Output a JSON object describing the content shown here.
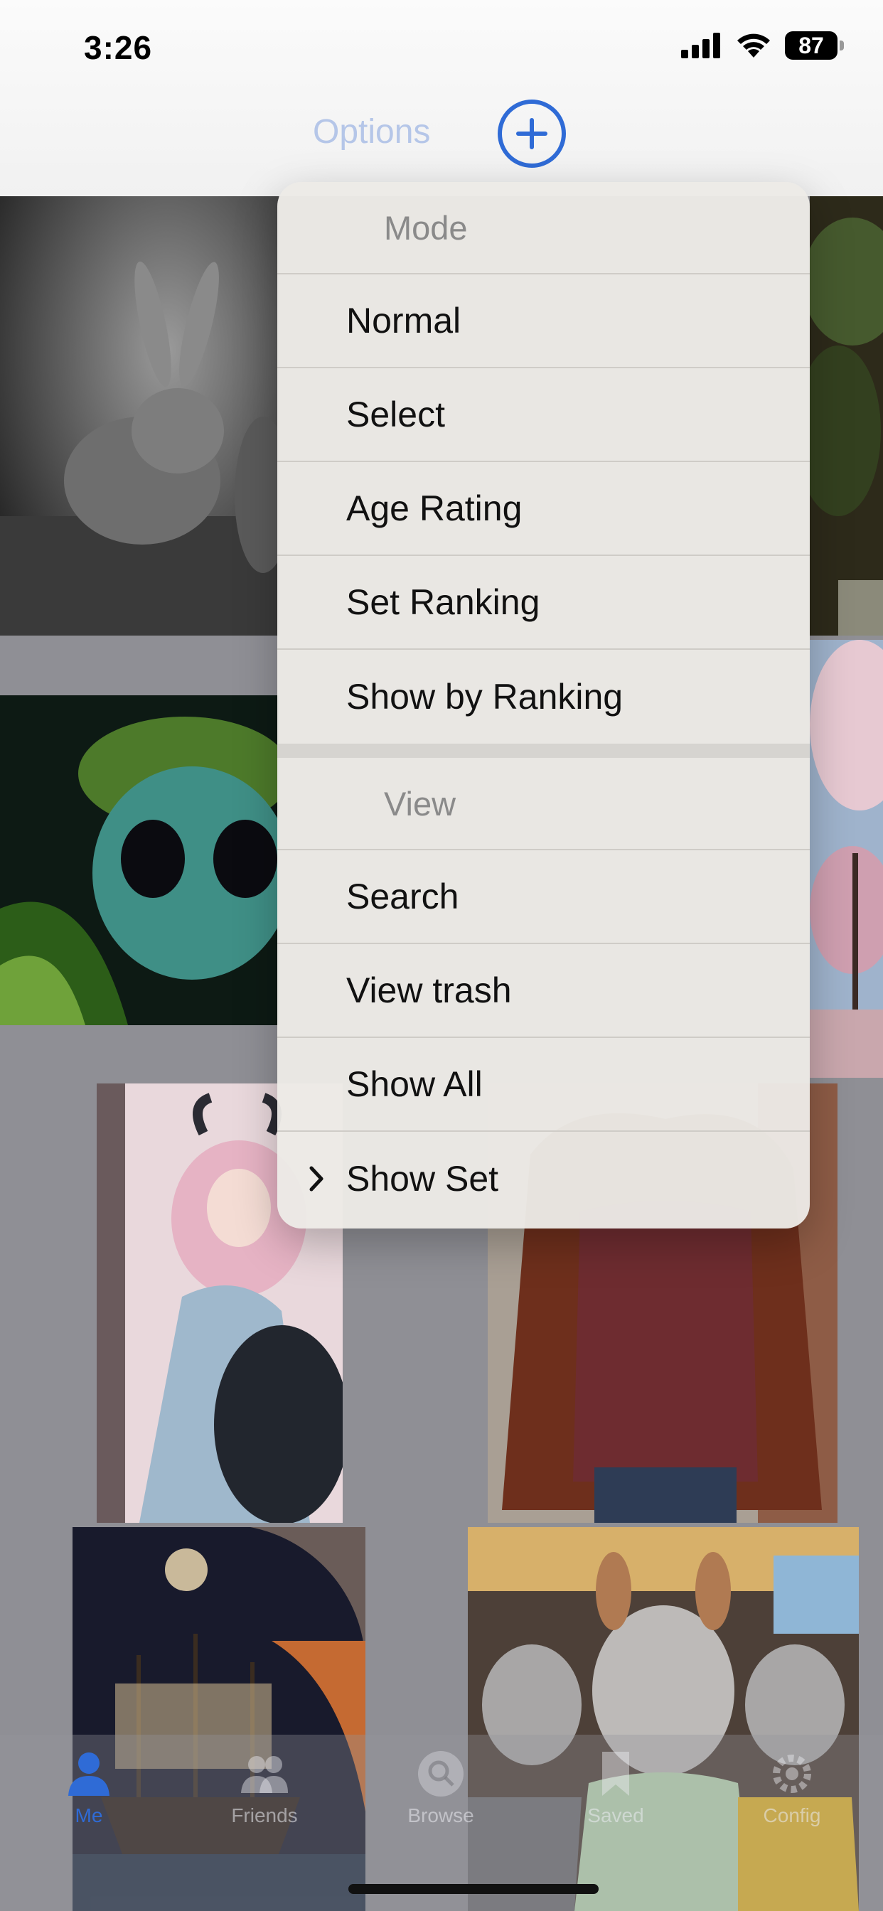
{
  "status_bar": {
    "time": "3:26",
    "battery": "87"
  },
  "header": {
    "options_label": "Options",
    "accent_color": "#2f6bd6"
  },
  "menu": {
    "sections": [
      {
        "header": "Mode",
        "items": [
          "Normal",
          "Select",
          "Age Rating",
          "Set Ranking",
          "Show by Ranking"
        ]
      },
      {
        "header": "View",
        "items": [
          "Search",
          "View trash",
          "Show All",
          "Show Set"
        ]
      }
    ]
  },
  "tab_bar": {
    "tabs": [
      {
        "label": "Me",
        "icon": "person-icon",
        "active": true
      },
      {
        "label": "Friends",
        "icon": "people-icon",
        "active": false
      },
      {
        "label": "Browse",
        "icon": "search-icon",
        "active": false
      },
      {
        "label": "Saved",
        "icon": "bookmark-icon",
        "active": false
      },
      {
        "label": "Config",
        "icon": "gear-icon",
        "active": false
      }
    ]
  }
}
